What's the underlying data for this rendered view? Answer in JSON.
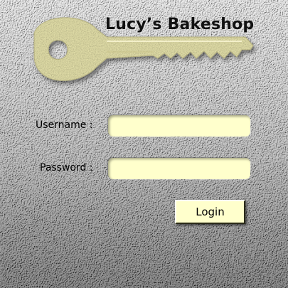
{
  "app": {
    "title": "Lucy’s Bakeshop"
  },
  "form": {
    "username_label": "Username :",
    "username_value": "",
    "password_label": "Password :",
    "password_value": "",
    "login_label": "Login"
  },
  "icons": {
    "key": "key-icon"
  },
  "colors": {
    "field_background": "#ffffcc",
    "key_color": "#efebb2",
    "button_background": "#ffffcc"
  }
}
